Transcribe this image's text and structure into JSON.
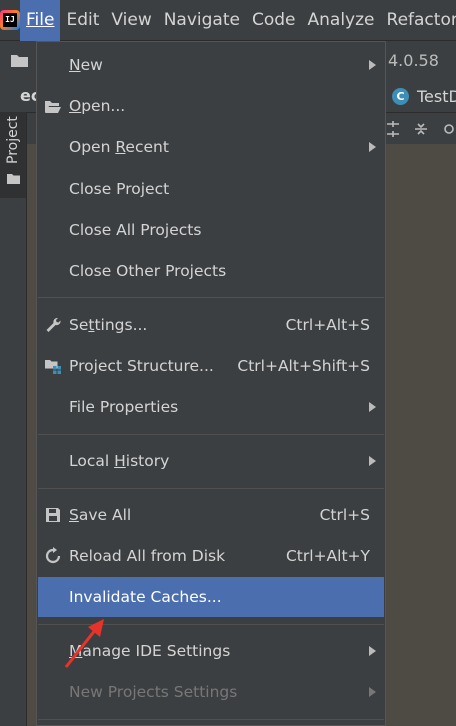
{
  "menubar": {
    "items": [
      {
        "label": "File",
        "active": true
      },
      {
        "label": "Edit"
      },
      {
        "label": "View"
      },
      {
        "label": "Navigate"
      },
      {
        "label": "Code"
      },
      {
        "label": "Analyze"
      },
      {
        "label": "Refactor"
      }
    ]
  },
  "toolbar2": {
    "version_text": "4.0.58"
  },
  "tabs": {
    "left_partial": "ec",
    "right_tab_icon": "C",
    "right_tab_label": "TestD"
  },
  "left_strip": {
    "project_label": "Project"
  },
  "file_menu": {
    "new": {
      "label": "New",
      "mnemonic": "N",
      "rest": "ew"
    },
    "open": {
      "pre": "",
      "mnemonic": "O",
      "rest": "pen..."
    },
    "open_recent": {
      "pre": "Open ",
      "mnemonic": "R",
      "rest": "ecent"
    },
    "close_project": {
      "label": "Close Project"
    },
    "close_all_projects": {
      "label": "Close All Projects"
    },
    "close_other_projects": {
      "label": "Close Other Projects"
    },
    "settings": {
      "pre": "Se",
      "mnemonic": "t",
      "rest": "tings...",
      "shortcut": "Ctrl+Alt+S"
    },
    "project_structure": {
      "label": "Project Structure...",
      "shortcut": "Ctrl+Alt+Shift+S"
    },
    "file_properties": {
      "label": "File Properties"
    },
    "local_history": {
      "pre": "Local ",
      "mnemonic": "H",
      "rest": "istory"
    },
    "save_all": {
      "pre": "",
      "mnemonic": "S",
      "rest": "ave All",
      "shortcut": "Ctrl+S"
    },
    "reload_all": {
      "label": "Reload All from Disk",
      "shortcut": "Ctrl+Alt+Y"
    },
    "invalidate_caches": {
      "label": "Invalidate Caches..."
    },
    "manage_ide_settings": {
      "pre": "",
      "mnemonic": "M",
      "rest": "anage IDE Settings"
    },
    "new_projects_settings": {
      "label": "New Projects Settings"
    }
  },
  "colors": {
    "menu_bg": "#3c3f41",
    "selection": "#4b6eaf",
    "editor_bg": "#4e4a44",
    "annotation_arrow": "#e8332a"
  }
}
